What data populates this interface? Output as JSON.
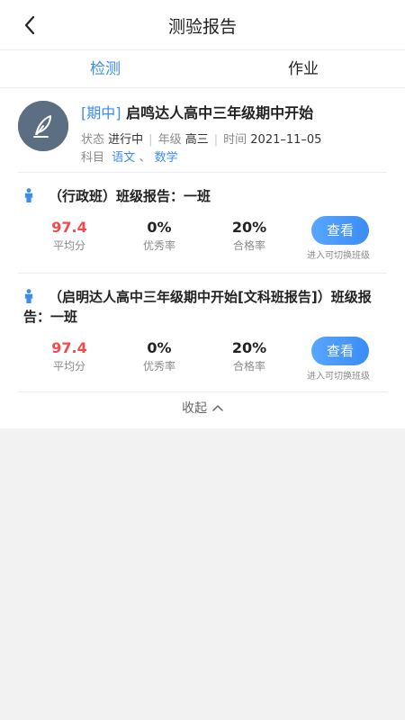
{
  "header": {
    "title": "测验报告"
  },
  "tabs": [
    {
      "label": "检测"
    },
    {
      "label": "作业"
    }
  ],
  "exam": {
    "tag": "[期中]",
    "title": "启鸣达人高中三年级期中开始",
    "status_label": "状态",
    "status_value": "进行中",
    "grade_label": "年级",
    "grade_value": "高三",
    "time_label": "时间",
    "time_value": "2021–11–05",
    "subject_label": "科目",
    "subjects": [
      "语文",
      "数学"
    ],
    "subject_sep": "、"
  },
  "reports": [
    {
      "title": "（行政班）班级报告：一班",
      "avg": "97.4",
      "avg_label": "平均分",
      "excellent": "0%",
      "excellent_label": "优秀率",
      "pass": "20%",
      "pass_label": "合格率",
      "button": "查看",
      "hint": "进入可切换班级"
    },
    {
      "title": "（启明达人高中三年级期中开始[文科班报告]）班级报告：一班",
      "avg": "97.4",
      "avg_label": "平均分",
      "excellent": "0%",
      "excellent_label": "优秀率",
      "pass": "20%",
      "pass_label": "合格率",
      "button": "查看",
      "hint": "进入可切换班级"
    }
  ],
  "collapse_label": "收起",
  "colors": {
    "accent": "#3b8cf5",
    "highlight": "#f04a4a"
  }
}
